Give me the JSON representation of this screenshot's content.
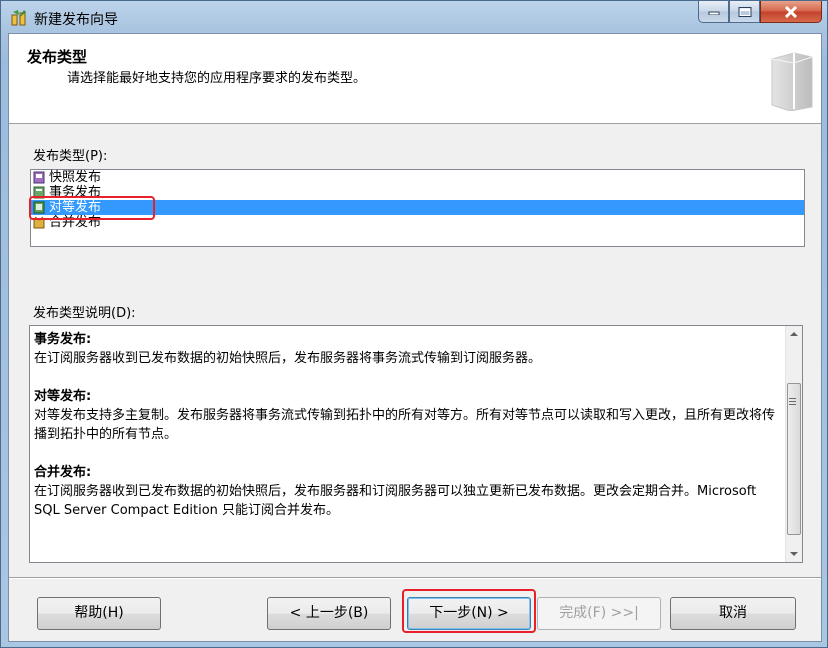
{
  "window": {
    "title": "新建发布向导"
  },
  "header": {
    "title": "发布类型",
    "subtitle": "请选择能最好地支持您的应用程序要求的发布类型。"
  },
  "publication_types": {
    "label": "发布类型(P):",
    "items": [
      {
        "label": "快照发布",
        "icon": "snapshot-publication-icon"
      },
      {
        "label": "事务发布",
        "icon": "transactional-publication-icon"
      },
      {
        "label": "对等发布",
        "icon": "peer-to-peer-publication-icon",
        "selected": true
      },
      {
        "label": "合并发布",
        "icon": "merge-publication-icon"
      }
    ]
  },
  "description": {
    "label": "发布类型说明(D):",
    "sections": [
      {
        "title": "事务发布:",
        "text": "在订阅服务器收到已发布数据的初始快照后，发布服务器将事务流式传输到订阅服务器。"
      },
      {
        "title": "对等发布:",
        "text": "对等发布支持多主复制。发布服务器将事务流式传输到拓扑中的所有对等方。所有对等节点可以读取和写入更改，且所有更改将传播到拓扑中的所有节点。"
      },
      {
        "title": "合并发布:",
        "text": "在订阅服务器收到已发布数据的初始快照后，发布服务器和订阅服务器可以独立更新已发布数据。更改会定期合并。Microsoft SQL Server Compact Edition 只能订阅合并发布。"
      }
    ]
  },
  "buttons": {
    "help": "帮助(H)",
    "back": "< 上一步(B)",
    "next": "下一步(N) >",
    "finish": "完成(F) >>|",
    "cancel": "取消"
  },
  "colors": {
    "selection": "#3399ff",
    "highlight": "#e8202a"
  }
}
